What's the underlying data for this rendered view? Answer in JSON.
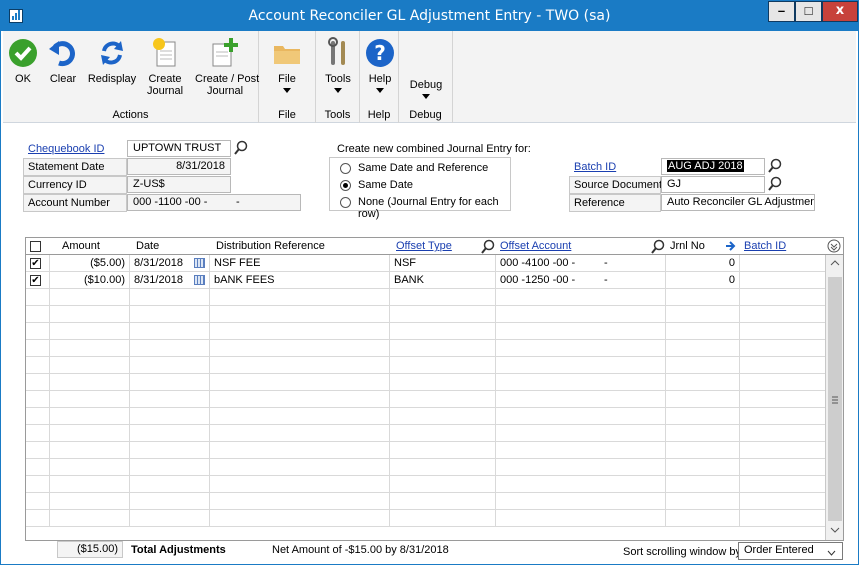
{
  "window": {
    "title": "Account Reconciler GL Adjustment Entry  -  TWO (sa)",
    "minimize": "–",
    "maximize": "□",
    "close": "x"
  },
  "ribbon": {
    "ok": "OK",
    "clear": "Clear",
    "redisplay": "Redisplay",
    "create_journal_1": "Create",
    "create_journal_2": "Journal",
    "create_post_1": "Create / Post",
    "create_post_2": "Journal",
    "actions_group": "Actions",
    "file": "File",
    "file_group": "File",
    "tools": "Tools",
    "tools_group": "Tools",
    "help": "Help",
    "help_group": "Help",
    "debug": "Debug",
    "debug_group": "Debug"
  },
  "left_fields": {
    "chequebook_label": "Chequebook ID",
    "chequebook_value": "UPTOWN TRUST",
    "statement_label": "Statement Date",
    "statement_value": "8/31/2018",
    "currency_label": "Currency ID",
    "currency_value": "Z-US$",
    "account_label": "Account Number",
    "account_value": "000 -1100 -00 -",
    "account_suffix": "-"
  },
  "journal_options": {
    "heading": "Create new combined Journal Entry for:",
    "opt1": "Same Date and Reference",
    "opt2": "Same Date",
    "opt3": "None (Journal Entry for each row)",
    "selected": "Same Date"
  },
  "right_fields": {
    "batch_label": "Batch ID",
    "batch_value": "AUG ADJ 2018",
    "source_label": "Source Document",
    "source_value": "GJ",
    "reference_label": "Reference",
    "reference_value": "Auto Reconciler GL Adjustments"
  },
  "grid": {
    "headers": {
      "amount": "Amount",
      "date": "Date",
      "dist_ref": "Distribution Reference",
      "offset_type": "Offset Type",
      "offset_account": "Offset Account",
      "jrnl_no": "Jrnl No",
      "batch_id": "Batch ID"
    },
    "rows": [
      {
        "checked": true,
        "amount": "($5.00)",
        "date": "8/31/2018",
        "dist_ref": "NSF FEE",
        "offset_type": "NSF",
        "offset_account": "000 -4100 -00 -",
        "acct_suffix": "-",
        "jrnl_no": "0",
        "batch_id": ""
      },
      {
        "checked": true,
        "amount": "($10.00)",
        "date": "8/31/2018",
        "dist_ref": "bANK FEES",
        "offset_type": "BANK",
        "offset_account": "000 -1250 -00 -",
        "acct_suffix": "-",
        "jrnl_no": "0",
        "batch_id": ""
      }
    ]
  },
  "footer": {
    "total_amount": "($15.00)",
    "total_label": "Total Adjustments",
    "net_text": "Net Amount of -$15.00 by 8/31/2018",
    "sort_label": "Sort scrolling window by",
    "sort_value": "Order Entered"
  },
  "colors": {
    "title_bar": "#1a7bc5",
    "link": "#1a3fb0",
    "ok_green": "#3aa02c",
    "help_blue": "#1c64c8"
  }
}
